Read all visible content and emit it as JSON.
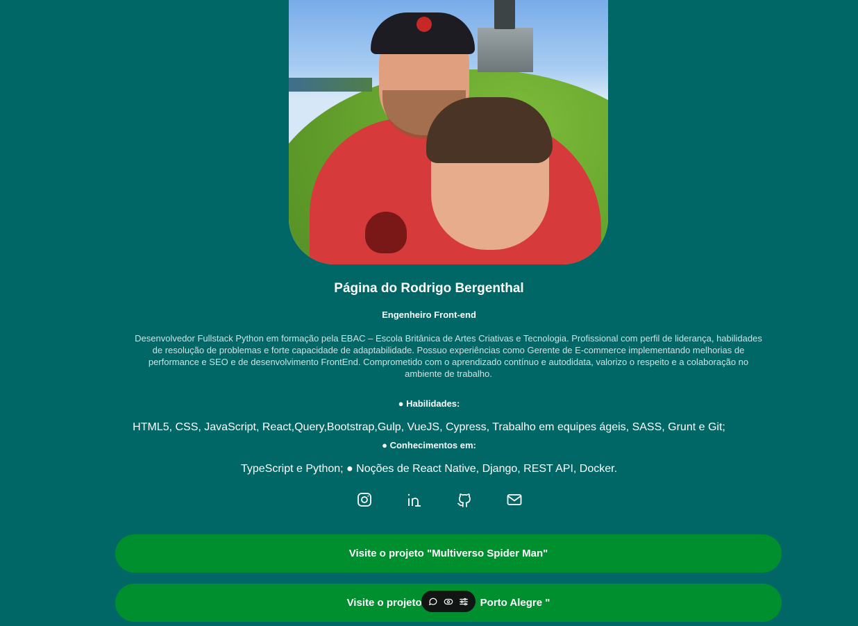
{
  "profile": {
    "title": "Página do Rodrigo Bergenthal",
    "role": "Engenheiro Front-end",
    "bio": "Desenvolvedor Fullstack Python em formação pela EBAC – Escola Britânica de Artes Criativas e Tecnologia. Profissional com perfil de liderança, habilidades de resolução de problemas e forte capacidade de adaptabilidade. Possuo experiências como Gerente de E-commerce implementando melhorias de performance e SEO e de desenvolvimento FrontEnd. Comprometido com o aprendizado contínuo e autodidata, valorizo o respeito e a colaboração no ambiente de trabalho."
  },
  "skills": {
    "heading": "● Habilidades:",
    "text": "HTML5, CSS, JavaScript, React,Query,Bootstrap,Gulp, VueJS, Cypress, Trabalho em equipes ágeis, SASS, Grunt e Git;"
  },
  "knowledge": {
    "heading": "● Conhecimentos em:",
    "text": "TypeScript e Python; ● Noções de React Native, Django, REST API, Docker."
  },
  "socials": [
    {
      "icon": "instagram-icon"
    },
    {
      "icon": "linkedin-icon"
    },
    {
      "icon": "github-icon"
    },
    {
      "icon": "mail-icon"
    }
  ],
  "buttons": {
    "project1": "Visite o projeto \"Multiverso Spider Man\"",
    "project2_left": "Visite o projeto",
    "project2_right": "Porto Alegre \""
  },
  "toolbar": {
    "icons": [
      "comment-icon",
      "eye-icon",
      "settings-icon"
    ]
  },
  "colors": {
    "background": "#006666",
    "button": "#008f2e",
    "toolbar": "#111614"
  }
}
